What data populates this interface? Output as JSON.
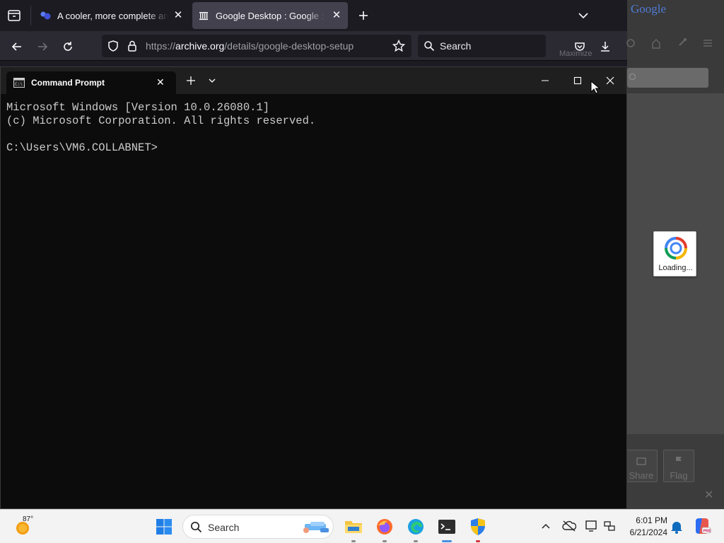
{
  "browser": {
    "tabs": [
      {
        "title": "A cooler, more complete and a",
        "active": false,
        "icon": "brand-logo-icon"
      },
      {
        "title": "Google Desktop : Google : Free",
        "active": true,
        "icon": "archive-icon"
      }
    ],
    "url": {
      "prefix": "https://",
      "host": "archive.org",
      "path": "/details/google-desktop-setup"
    },
    "search_placeholder": "Search",
    "tooltip": "Maximize"
  },
  "google_desktop": {
    "logo": "Google",
    "loading": "Loading...",
    "buttons": [
      "Share",
      "Flag"
    ]
  },
  "terminal": {
    "tab_title": "Command Prompt",
    "lines": [
      "Microsoft Windows [Version 10.0.26080.1]",
      "(c) Microsoft Corporation. All rights reserved.",
      "",
      "C:\\Users\\VM6.COLLABNET>"
    ]
  },
  "taskbar": {
    "weather_temp": "87°",
    "search_placeholder": "Search",
    "time": "6:01 PM",
    "date": "6/21/2024",
    "apps": [
      "start",
      "file-explorer",
      "firefox",
      "edge",
      "terminal",
      "security"
    ]
  },
  "colors": {
    "firefox_dark": "#1c1b22",
    "terminal_bg": "#0c0c0c",
    "taskbar_bg": "#f3f3f3",
    "notification": "#0f6cbd"
  }
}
